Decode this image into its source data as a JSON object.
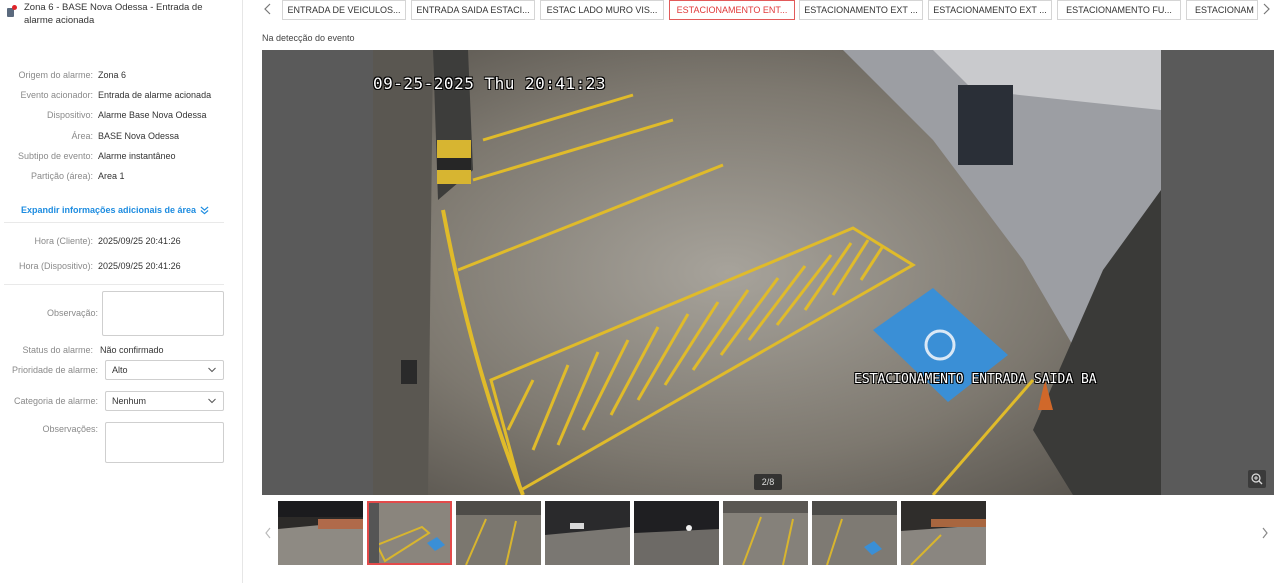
{
  "alarm": {
    "title": "Zona 6 - BASE Nova Odessa - Entrada de alarme acionada"
  },
  "details": [
    {
      "label": "Origem do alarme:",
      "value": "Zona 6"
    },
    {
      "label": "Evento acionador:",
      "value": "Entrada de alarme acionada"
    },
    {
      "label": "Dispositivo:",
      "value": "Alarme Base Nova Odessa"
    },
    {
      "label": "Área:",
      "value": "BASE Nova Odessa"
    },
    {
      "label": "Subtipo de evento:",
      "value": "Alarme instantâneo"
    },
    {
      "label": "Partição (área):",
      "value": "Area 1"
    }
  ],
  "expand_label": "Expandir informações adicionais de área",
  "times": [
    {
      "label": "Hora (Cliente):",
      "value": "2025/09/25 20:41:26"
    },
    {
      "label": "Hora (Dispositivo):",
      "value": "2025/09/25 20:41:26"
    }
  ],
  "form": {
    "observacao_label": "Observação:",
    "observacao_value": "",
    "status_label": "Status do alarme:",
    "status_value": "Não confirmado",
    "priority_label": "Prioridade de alarme:",
    "priority_value": "Alto",
    "category_label": "Categoria de alarme:",
    "category_value": "Nenhum",
    "observacoes_label": "Observações:",
    "observacoes_value": ""
  },
  "tabs": [
    {
      "label": "ENTRADA DE VEICULOS...",
      "active": false
    },
    {
      "label": "ENTRADA SAIDA ESTACI...",
      "active": false
    },
    {
      "label": "ESTAC LADO MURO VIS...",
      "active": false
    },
    {
      "label": "ESTACIONAMENTO ENT...",
      "active": true
    },
    {
      "label": "ESTACIONAMENTO EXT ...",
      "active": false
    },
    {
      "label": "ESTACIONAMENTO EXT ...",
      "active": false
    },
    {
      "label": "ESTACIONAMENTO FU...",
      "active": false
    },
    {
      "label": "ESTACIONAM",
      "active": false
    }
  ],
  "viewer": {
    "caption": "Na detecção do evento",
    "osd_timestamp": "09-25-2025 Thu 20:41:23",
    "osd_camera": "ESTACIONAMENTO ENTRADA SAIDA BA",
    "counter": "2/8"
  },
  "thumbnails": {
    "count": 8,
    "selected_index": 1
  },
  "colors": {
    "accent": "#1d8ce0",
    "active_tab": "#e0393a",
    "alarm_dot": "#e0242a"
  }
}
